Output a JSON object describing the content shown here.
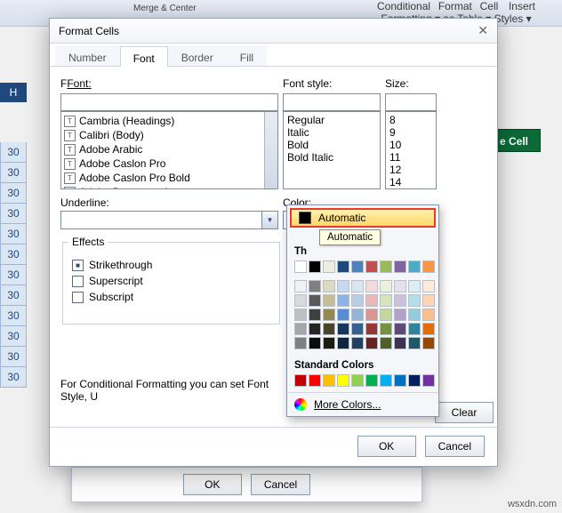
{
  "ribbon": {
    "merge_center": "Merge & Center",
    "conditional": "Conditional",
    "format": "Format",
    "cell": "Cell",
    "insert": "Insert",
    "sub_line": "Formatting ▾ as Table ▾ Styles ▾"
  },
  "sheet": {
    "row_headers": [
      "30",
      "30",
      "30",
      "30",
      "30",
      "30",
      "30",
      "30",
      "30",
      "30",
      "30",
      "30"
    ],
    "colhead": "H",
    "green_cell": "e Cell"
  },
  "dialog": {
    "title": "Format Cells",
    "tabs": [
      "Number",
      "Font",
      "Border",
      "Fill"
    ],
    "active_tab": 1,
    "font_label": "Font:",
    "font_value": "",
    "font_list": [
      "Cambria (Headings)",
      "Calibri (Body)",
      "Adobe Arabic",
      "Adobe Caslon Pro",
      "Adobe Caslon Pro Bold",
      "Adobe Devanagari"
    ],
    "font_style_label": "Font style:",
    "font_style_value": "",
    "font_styles": [
      "Regular",
      "Italic",
      "Bold",
      "Bold Italic"
    ],
    "size_label": "Size:",
    "size_value": "",
    "sizes": [
      "8",
      "9",
      "10",
      "11",
      "12",
      "14"
    ],
    "underline_label": "Underline:",
    "underline_value": "",
    "color_label": "Color:",
    "color_value": "Automatic",
    "effects_label": "Effects",
    "effects": {
      "strikethrough": "Strikethrough",
      "superscript": "Superscript",
      "subscript": "Subscript"
    },
    "note": "For Conditional Formatting you can set Font Style, U",
    "clear": "Clear",
    "ok": "OK",
    "cancel": "Cancel"
  },
  "flyout": {
    "automatic": "Automatic",
    "tooltip": "Automatic",
    "theme_label": "Th",
    "theme_colors_row1": [
      "#ffffff",
      "#000000",
      "#eeece1",
      "#1f497d",
      "#4f81bd",
      "#c0504d",
      "#9bbb59",
      "#8064a2",
      "#4bacc6",
      "#f79646"
    ],
    "theme_shades": [
      [
        "#f2f2f2",
        "#7f7f7f",
        "#ddd9c3",
        "#c6d9f0",
        "#dbe5f1",
        "#f2dcdb",
        "#ebf1dd",
        "#e5e0ec",
        "#dbeef3",
        "#fdeada"
      ],
      [
        "#d9d9d9",
        "#595959",
        "#c4bd97",
        "#8db3e2",
        "#b8cce4",
        "#e5b9b7",
        "#d7e3bc",
        "#ccc1d9",
        "#b7dde8",
        "#fbd5b5"
      ],
      [
        "#bfbfbf",
        "#404040",
        "#938953",
        "#548dd4",
        "#95b3d7",
        "#d99694",
        "#c3d69b",
        "#b2a2c7",
        "#92cddc",
        "#fac08f"
      ],
      [
        "#a6a6a6",
        "#262626",
        "#494429",
        "#17365d",
        "#366092",
        "#953734",
        "#76923c",
        "#5f497a",
        "#31859b",
        "#e36c09"
      ],
      [
        "#808080",
        "#0d0d0d",
        "#1d1b10",
        "#0f243e",
        "#244061",
        "#632423",
        "#4f6128",
        "#3f3151",
        "#205867",
        "#974806"
      ]
    ],
    "standard_label": "Standard Colors",
    "standard_colors": [
      "#c00000",
      "#ff0000",
      "#ffc000",
      "#ffff00",
      "#92d050",
      "#00b050",
      "#00b0f0",
      "#0070c0",
      "#002060",
      "#7030a0"
    ],
    "more_colors": "More Colors..."
  },
  "behind": {
    "ok": "OK",
    "cancel": "Cancel"
  },
  "watermark": "wsxdn.com"
}
